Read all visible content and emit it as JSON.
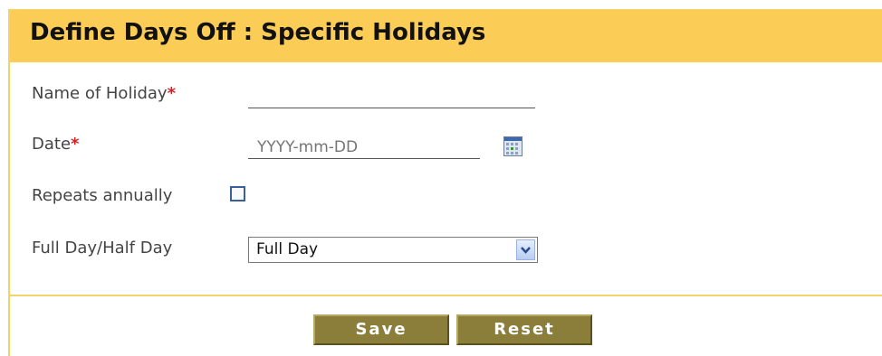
{
  "header": {
    "title": "Define Days Off : Specific Holidays"
  },
  "form": {
    "holiday_name": {
      "label": "Name of Holiday",
      "required_marker": "*",
      "value": ""
    },
    "date": {
      "label": "Date",
      "required_marker": "*",
      "placeholder": "YYYY-mm-DD",
      "icon": "calendar-icon"
    },
    "repeats_annually": {
      "label": "Repeats annually",
      "checked": false
    },
    "day_type": {
      "label": "Full Day/Half Day",
      "selected": "Full Day",
      "icon": "chevron-down-icon"
    }
  },
  "actions": {
    "save_label": "Save",
    "reset_label": "Reset"
  },
  "colors": {
    "title_bar": "#fbcd57",
    "border": "#f5d36a",
    "button": "#8b7e3a",
    "required": "#d42020"
  }
}
